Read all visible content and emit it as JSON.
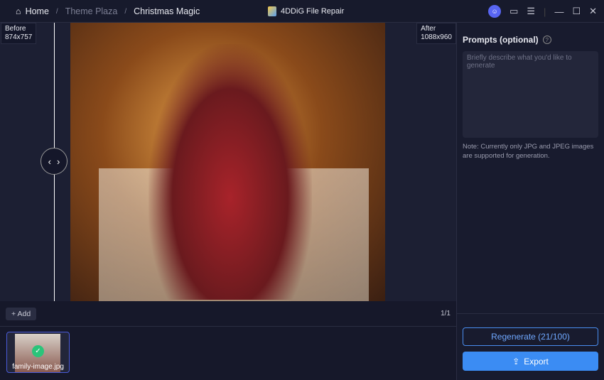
{
  "breadcrumb": {
    "home": "Home",
    "theme": "Theme Plaza",
    "current": "Christmas Magic"
  },
  "app_title": "4DDiG File Repair",
  "compare": {
    "before_label": "Before",
    "before_size": "874x757",
    "after_label": "After",
    "after_size": "1088x960"
  },
  "toolbar": {
    "add_label": "Add",
    "page_count": "1/1"
  },
  "thumbnails": [
    {
      "name": "family-image.jpg",
      "status": "done"
    }
  ],
  "prompts": {
    "title": "Prompts (optional)",
    "placeholder": "Briefly describe what you'd like to generate",
    "value": "",
    "note": "Note: Currently only JPG and JPEG images are supported for generation."
  },
  "actions": {
    "regenerate": "Regenerate (21/100)",
    "export": "Export"
  }
}
